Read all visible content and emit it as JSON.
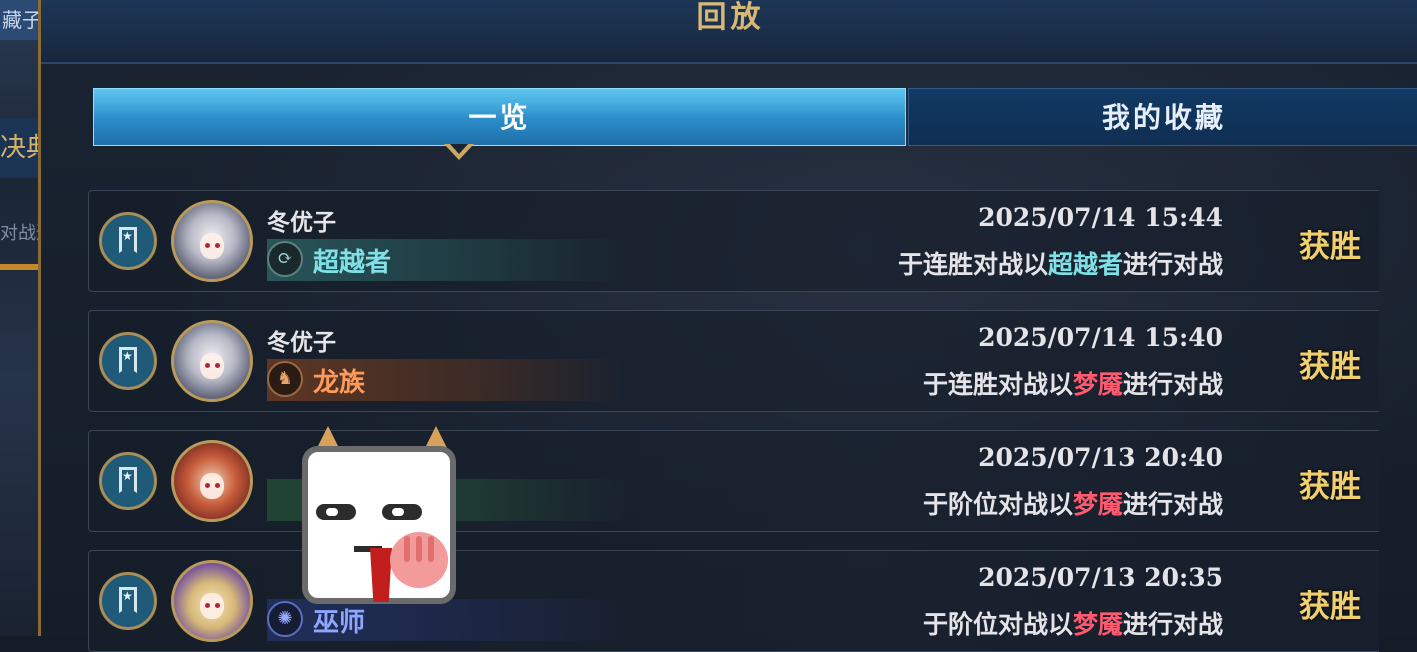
{
  "left_sidebar": {
    "fragment_top": "藏子",
    "fragment_mid": "决典",
    "fragment_low": "对战通行证 赏"
  },
  "header": {
    "title": "回放"
  },
  "tabs": [
    {
      "label": "一览",
      "active": true
    },
    {
      "label": "我的收藏",
      "active": false
    }
  ],
  "replays": [
    {
      "player": "冬优子",
      "class_label": "超越者",
      "class_icon": "portal-swirl-icon",
      "datetime": "2025/07/14  15:44",
      "desc_prefix": "于连胜对战以",
      "opponent_class": "超越者",
      "desc_suffix": "进行对战",
      "result": "获胜"
    },
    {
      "player": "冬优子",
      "class_label": "龙族",
      "class_icon": "dragon-icon",
      "datetime": "2025/07/14  15:40",
      "desc_prefix": "于连胜对战以",
      "opponent_class": "梦魇",
      "desc_suffix": "进行对战",
      "result": "获胜"
    },
    {
      "player": "",
      "class_label": "",
      "class_icon": "",
      "datetime": "2025/07/13  20:40",
      "desc_prefix": "于阶位对战以",
      "opponent_class": "梦魇",
      "desc_suffix": "进行对战",
      "result": "获胜"
    },
    {
      "player": "",
      "class_label": "巫师",
      "class_icon": "rune-circle-icon",
      "datetime": "2025/07/13  20:35",
      "desc_prefix": "于阶位对战以",
      "opponent_class": "梦魇",
      "desc_suffix": "进行对战",
      "result": "获胜"
    }
  ],
  "colors": {
    "accent_gold": "#d9b873",
    "tab_active": "#2b8cc8",
    "highlight_teal": "#7fe0e6",
    "highlight_red": "#ff5a6e",
    "result_gold": "#f1cf6d"
  }
}
